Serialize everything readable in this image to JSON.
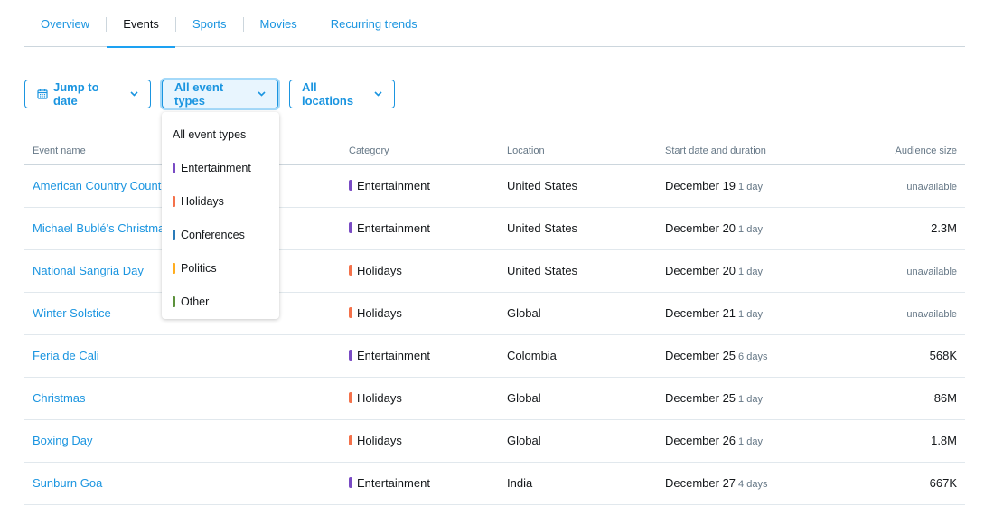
{
  "tabs": [
    {
      "label": "Overview",
      "active": false
    },
    {
      "label": "Events",
      "active": true
    },
    {
      "label": "Sports",
      "active": false
    },
    {
      "label": "Movies",
      "active": false
    },
    {
      "label": "Recurring trends",
      "active": false
    }
  ],
  "filters": {
    "jump_to_date": "Jump to date",
    "event_types": "All event types",
    "locations": "All locations"
  },
  "dropdown": {
    "items": [
      {
        "label": "All event types",
        "color": null
      },
      {
        "label": "Entertainment",
        "color": "#794bc4"
      },
      {
        "label": "Holidays",
        "color": "#f4714a"
      },
      {
        "label": "Conferences",
        "color": "#2b7bb9"
      },
      {
        "label": "Politics",
        "color": "#ffad1f"
      },
      {
        "label": "Other",
        "color": "#5c913b"
      }
    ]
  },
  "category_colors": {
    "Entertainment": "#794bc4",
    "Holidays": "#f4714a"
  },
  "table": {
    "headers": {
      "event_name": "Event name",
      "category": "Category",
      "location": "Location",
      "start": "Start date and duration",
      "audience": "Audience size"
    },
    "rows": [
      {
        "name": "American Country Countdown Awards",
        "category": "Entertainment",
        "location": "United States",
        "date": "December 19",
        "duration": "1 day",
        "audience": "unavailable"
      },
      {
        "name": "Michael Bublé's Christmas",
        "category": "Entertainment",
        "location": "United States",
        "date": "December 20",
        "duration": "1 day",
        "audience": "2.3M"
      },
      {
        "name": "National Sangria Day",
        "category": "Holidays",
        "location": "United States",
        "date": "December 20",
        "duration": "1 day",
        "audience": "unavailable"
      },
      {
        "name": "Winter Solstice",
        "category": "Holidays",
        "location": "Global",
        "date": "December 21",
        "duration": "1 day",
        "audience": "unavailable"
      },
      {
        "name": "Feria de Cali",
        "category": "Entertainment",
        "location": "Colombia",
        "date": "December 25",
        "duration": "6 days",
        "audience": "568K"
      },
      {
        "name": "Christmas",
        "category": "Holidays",
        "location": "Global",
        "date": "December 25",
        "duration": "1 day",
        "audience": "86M"
      },
      {
        "name": "Boxing Day",
        "category": "Holidays",
        "location": "Global",
        "date": "December 26",
        "duration": "1 day",
        "audience": "1.8M"
      },
      {
        "name": "Sunburn Goa",
        "category": "Entertainment",
        "location": "India",
        "date": "December 27",
        "duration": "4 days",
        "audience": "667K"
      }
    ]
  }
}
